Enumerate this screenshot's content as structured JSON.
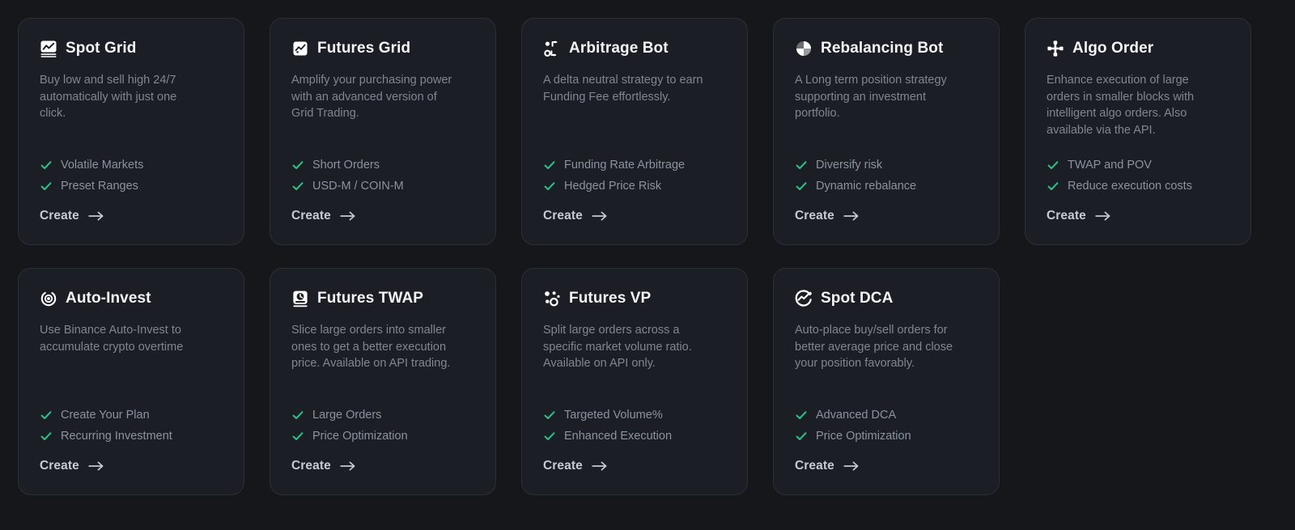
{
  "theme": {
    "background": "#15171b",
    "card_background": "#1b1e25",
    "card_border": "#2b2f38",
    "title_color": "#f3f4f6",
    "description_color": "#80868f",
    "feature_color": "#8b939d",
    "check_color": "#2ebd85",
    "create_color": "#c6cad2"
  },
  "cards": [
    {
      "icon": "line-chart-square-icon",
      "title": "Spot Grid",
      "description": "Buy low and sell high 24/7 automatically with just one click.",
      "features": [
        "Volatile Markets",
        "Preset Ranges"
      ],
      "create_label": "Create"
    },
    {
      "icon": "futures-chart-square-icon",
      "title": "Futures Grid",
      "description": "Amplify your purchasing power with an advanced version of Grid Trading.",
      "features": [
        "Short Orders",
        "USD-M / COIN-M"
      ],
      "create_label": "Create"
    },
    {
      "icon": "arbitrage-nodes-icon",
      "title": "Arbitrage Bot",
      "description": "A delta neutral strategy to earn Funding Fee effortlessly.",
      "features": [
        "Funding Rate Arbitrage",
        "Hedged Price Risk"
      ],
      "create_label": "Create"
    },
    {
      "icon": "pie-segments-icon",
      "title": "Rebalancing Bot",
      "description": "A Long term position strategy supporting an investment portfolio.",
      "features": [
        "Diversify risk",
        "Dynamic rebalance"
      ],
      "create_label": "Create"
    },
    {
      "icon": "algo-nodes-cross-icon",
      "title": "Algo Order",
      "description": "Enhance execution of large orders in smaller blocks with intelligent algo orders. Also available via the API.",
      "features": [
        "TWAP and POV",
        "Reduce execution costs"
      ],
      "create_label": "Create"
    },
    {
      "icon": "target-dot-icon",
      "title": "Auto-Invest",
      "description": "Use Binance Auto-Invest to accumulate crypto overtime",
      "features": [
        "Create Your Plan",
        "Recurring Investment"
      ],
      "create_label": "Create"
    },
    {
      "icon": "clock-square-icon",
      "title": "Futures TWAP",
      "description": "Slice large orders into smaller ones to get a better execution price. Available on API trading.",
      "features": [
        "Large Orders",
        "Price Optimization"
      ],
      "create_label": "Create"
    },
    {
      "icon": "volume-dots-icon",
      "title": "Futures VP",
      "description": "Split large orders across a specific market volume ratio. Available on API only.",
      "features": [
        "Targeted Volume%",
        "Enhanced Execution"
      ],
      "create_label": "Create"
    },
    {
      "icon": "dca-swirl-icon",
      "title": "Spot DCA",
      "description": "Auto-place buy/sell orders for better average price and close your position favorably.",
      "features": [
        "Advanced DCA",
        "Price Optimization"
      ],
      "create_label": "Create"
    }
  ]
}
